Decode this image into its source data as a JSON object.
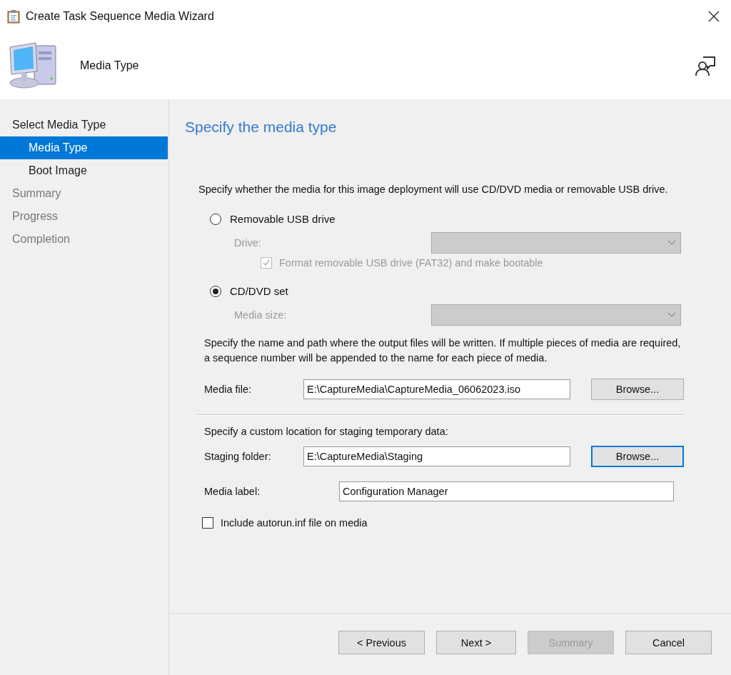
{
  "window": {
    "title": "Create Task Sequence Media Wizard"
  },
  "header": {
    "title": "Media Type"
  },
  "steps": [
    {
      "label": "Select Media Type",
      "selected": false,
      "disabled": false,
      "children": [
        {
          "label": "Media Type",
          "selected": true,
          "disabled": false
        },
        {
          "label": "Boot Image",
          "selected": false,
          "disabled": false
        }
      ]
    },
    {
      "label": "Summary",
      "selected": false,
      "disabled": true
    },
    {
      "label": "Progress",
      "selected": false,
      "disabled": true
    },
    {
      "label": "Completion",
      "selected": false,
      "disabled": true
    }
  ],
  "page": {
    "heading": "Specify the media type",
    "intro": "Specify whether the media for this image deployment will use CD/DVD media or removable USB drive.",
    "media_options": [
      {
        "label": "Removable USB drive",
        "selected": false,
        "dropdown_label": "Drive:",
        "dropdown_disabled": true,
        "checkbox": {
          "label": "Format removable USB drive (FAT32) and make bootable",
          "checked": true,
          "disabled": true
        }
      },
      {
        "label": "CD/DVD set",
        "selected": true,
        "dropdown_label": "Media size:",
        "dropdown_disabled": true
      }
    ],
    "output_text": "Specify the name and path where the output files will be written.  If multiple pieces of media are required, a sequence number will be appended to the name for each piece of media.",
    "media_file": {
      "label": "Media file:",
      "value": "E:\\CaptureMedia\\CaptureMedia_06062023.iso",
      "button": "Browse...",
      "focused": false
    },
    "staging_text": "Specify a custom location for staging temporary data:",
    "staging_folder": {
      "label": "Staging folder:",
      "value": "E:\\CaptureMedia\\Staging",
      "button": "Browse...",
      "focused": true
    },
    "media_label": {
      "label": "Media label:",
      "value": "Configuration Manager"
    },
    "autorun": {
      "label": "Include autorun.inf file on media",
      "checked": false
    }
  },
  "buttons": [
    {
      "label": "< Previous",
      "disabled": false
    },
    {
      "label": "Next >",
      "disabled": false
    },
    {
      "label": "Summary",
      "disabled": true
    },
    {
      "label": "Cancel",
      "disabled": false
    }
  ]
}
